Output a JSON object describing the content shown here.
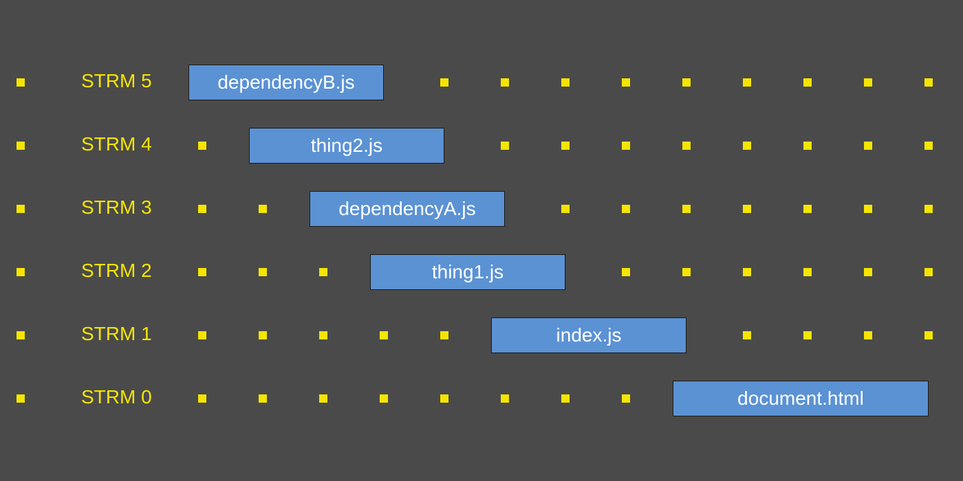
{
  "colors": {
    "bg": "#4a4a4a",
    "dot": "#f5e500",
    "label": "#f5e500",
    "block_fill": "#5b92d4",
    "block_border": "#1a1a1a",
    "block_text": "#ffffff"
  },
  "grid": {
    "x_start": 30,
    "x_step": 88,
    "cols": 16,
    "rows": [
      {
        "y": 120,
        "label_key": "streams.5.label"
      },
      {
        "y": 212,
        "label_key": "streams.4.label"
      },
      {
        "y": 304,
        "label_key": "streams.3.label"
      },
      {
        "y": 396,
        "label_key": "streams.2.label"
      },
      {
        "y": 488,
        "label_key": "streams.1.label"
      },
      {
        "y": 580,
        "label_key": "streams.0.label"
      }
    ],
    "label_col_start": 1,
    "label_col_span": 2,
    "label_x": 118,
    "dot_size": 12
  },
  "streams": {
    "0": {
      "label": "STRM 0",
      "block": "document.html",
      "start_col": 11,
      "span": 4
    },
    "1": {
      "label": "STRM 1",
      "block": "index.js",
      "start_col": 8,
      "span": 3
    },
    "2": {
      "label": "STRM 2",
      "block": "thing1.js",
      "start_col": 6,
      "span": 3
    },
    "3": {
      "label": "STRM 3",
      "block": "dependencyA.js",
      "start_col": 5,
      "span": 3
    },
    "4": {
      "label": "STRM 4",
      "block": "thing2.js",
      "start_col": 4,
      "span": 3
    },
    "5": {
      "label": "STRM 5",
      "block": "dependencyB.js",
      "start_col": 3,
      "span": 3
    }
  },
  "chart_data": {
    "type": "bar",
    "orientation": "horizontal-gantt",
    "title": "",
    "xlabel": "",
    "ylabel": "",
    "x_units": "grid cells",
    "categories": [
      "STRM 5",
      "STRM 4",
      "STRM 3",
      "STRM 2",
      "STRM 1",
      "STRM 0"
    ],
    "series": [
      {
        "name": "dependencyB.js",
        "category": "STRM 5",
        "start": 3,
        "span": 3
      },
      {
        "name": "thing2.js",
        "category": "STRM 4",
        "start": 4,
        "span": 3
      },
      {
        "name": "dependencyA.js",
        "category": "STRM 3",
        "start": 5,
        "span": 3
      },
      {
        "name": "thing1.js",
        "category": "STRM 2",
        "start": 6,
        "span": 3
      },
      {
        "name": "index.js",
        "category": "STRM 1",
        "start": 8,
        "span": 3
      },
      {
        "name": "document.html",
        "category": "STRM 0",
        "start": 11,
        "span": 4
      }
    ]
  }
}
